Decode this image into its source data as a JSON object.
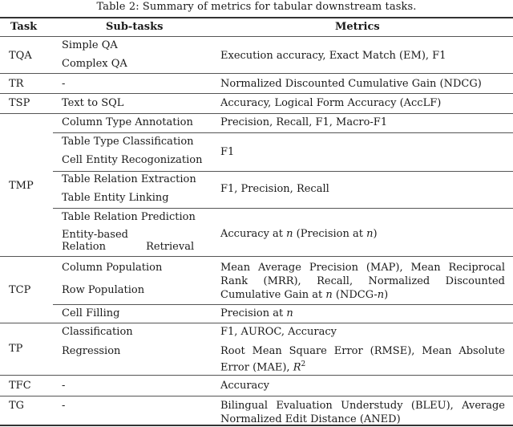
{
  "caption": "Table 2: Summary of metrics for tabular downstream tasks.",
  "headers": {
    "task": "Task",
    "subtasks": "Sub-tasks",
    "metrics": "Metrics"
  },
  "rows": {
    "tqa": {
      "task": "TQA",
      "sub": [
        "Simple QA",
        "Complex QA"
      ],
      "metric": "Execution accuracy, Exact Match (EM), F1"
    },
    "tr": {
      "task": "TR",
      "sub": [
        "-"
      ],
      "metric": "Normalized Discounted Cumulative Gain (NDCG)"
    },
    "tsp": {
      "task": "TSP",
      "sub": [
        "Text to SQL"
      ],
      "metric": "Accuracy, Logical Form Accuracy (AccLF)"
    },
    "tmp": {
      "task": "TMP",
      "groups": [
        {
          "sub": [
            "Column Type Annotation"
          ],
          "metric": "Precision, Recall, F1, Macro-F1"
        },
        {
          "sub": [
            "Table Type Classification",
            "Cell Entity Recogonization"
          ],
          "metric": "F1"
        },
        {
          "sub": [
            "Table Relation Extraction",
            "Table Entity Linking"
          ],
          "metric": "F1, Precision, Recall"
        },
        {
          "sub": [
            "Table Relation Prediction",
            "Entity-based Relation Retrieval"
          ],
          "metric_parts": [
            "Accuracy at ",
            "n",
            " (Precision at ",
            "n",
            ")"
          ]
        }
      ]
    },
    "tcp": {
      "task": "TCP",
      "groups": [
        {
          "sub": [
            "Column Population",
            "Row Population"
          ],
          "metric_parts": [
            "Mean Average Precision (MAP), Mean Reciprocal Rank (MRR), Recall, Normalized Discounted Cumulative Gain at ",
            "n",
            " (NDCG-",
            "n",
            ")"
          ]
        },
        {
          "sub": [
            "Cell Filling"
          ],
          "metric_parts": [
            "Precision at ",
            "n"
          ]
        }
      ]
    },
    "tp": {
      "task": "TP",
      "items": [
        {
          "sub": "Classification",
          "metric": "F1, AUROC, Accuracy"
        },
        {
          "sub": "Regression",
          "metric_parts": [
            "Root Mean Square Error (RMSE), Mean Absolute Error (MAE), ",
            "R",
            "2"
          ]
        }
      ]
    },
    "tfc": {
      "task": "TFC",
      "sub": [
        "-"
      ],
      "metric": "Accuracy"
    },
    "tg": {
      "task": "TG",
      "sub": [
        "-"
      ],
      "metric": "Bilingual Evaluation Understudy (BLEU), Average Normalized Edit Distance (ANED)"
    }
  }
}
